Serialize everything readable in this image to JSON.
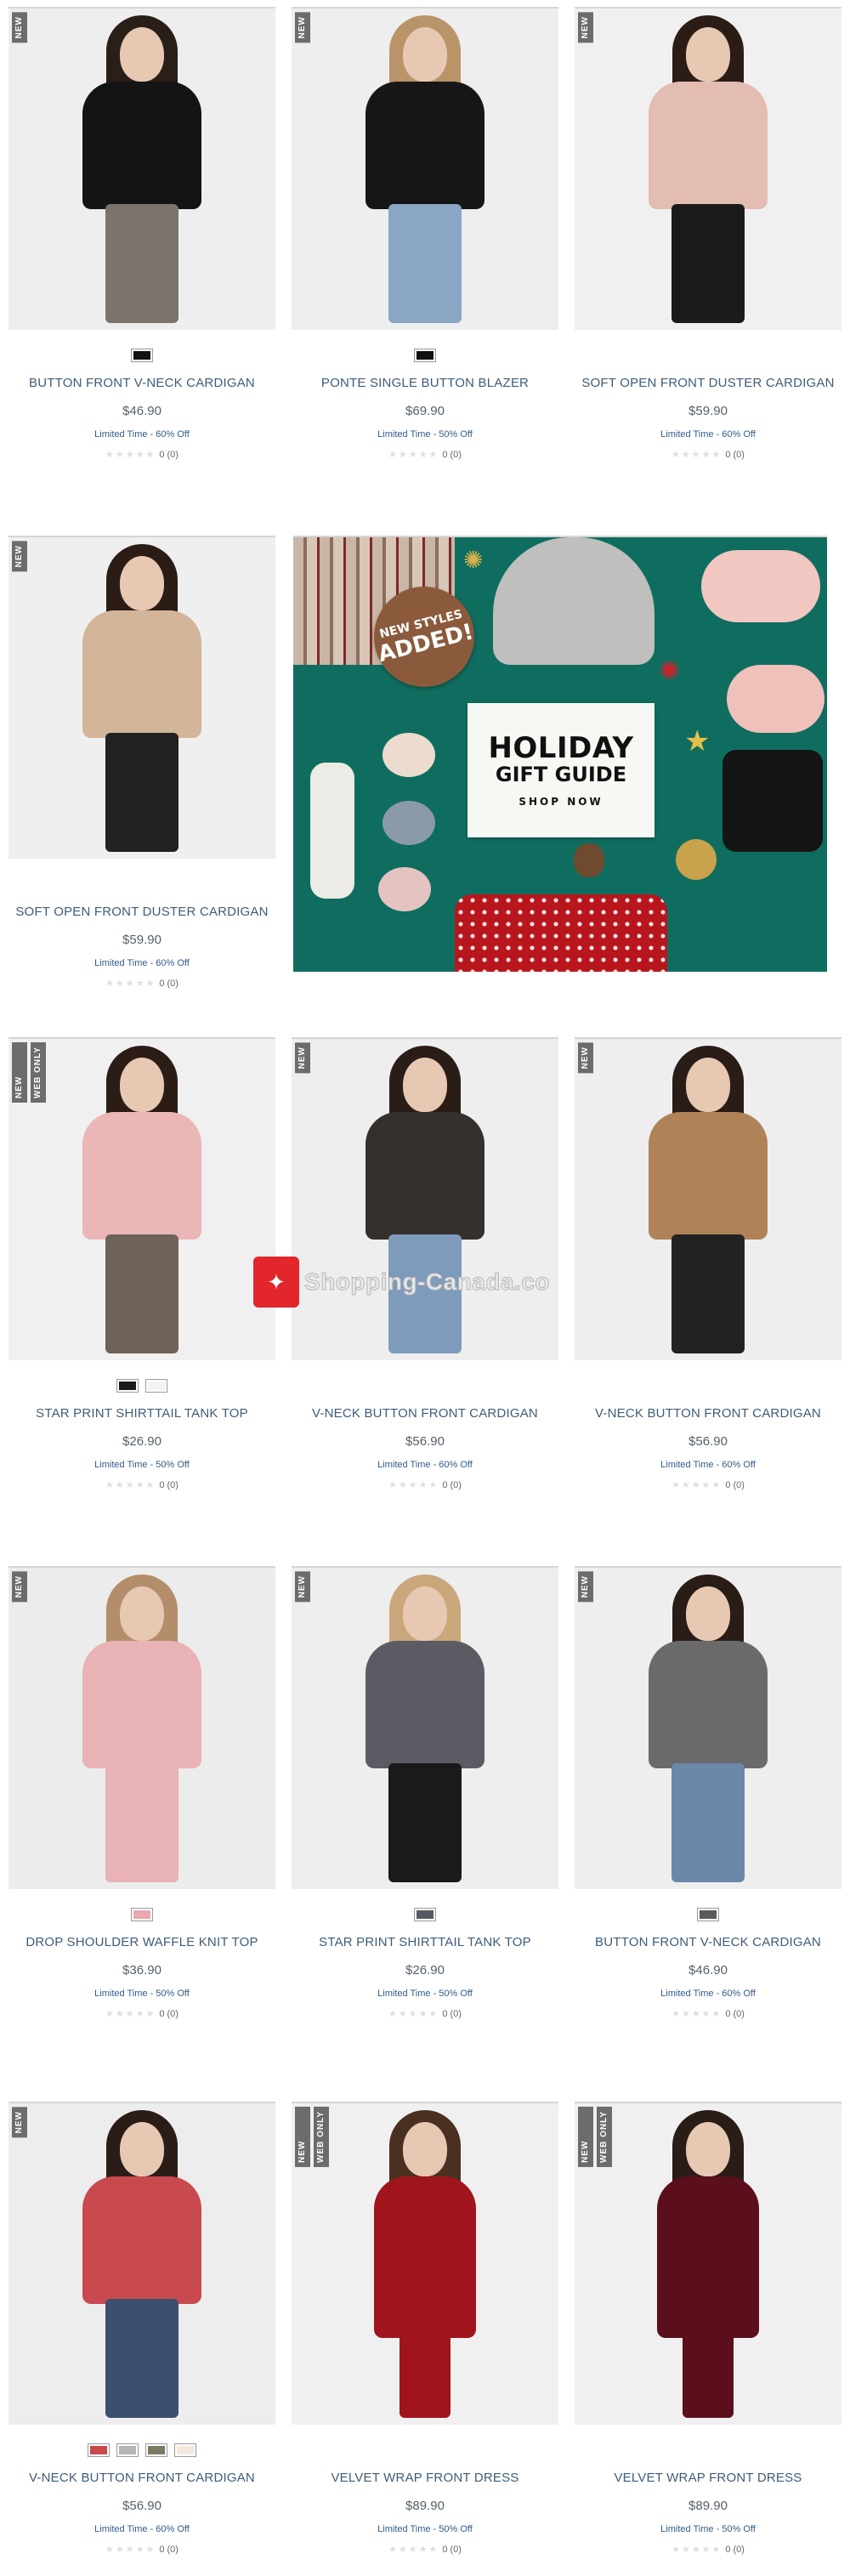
{
  "watermark": {
    "text": "Shopping-Canada.co",
    "icon": "maple-leaf-icon"
  },
  "banner": {
    "stamp_line1": "NEW STYLES",
    "stamp_line2": "ADDED!",
    "title": "HOLIDAY",
    "subtitle": "GIFT GUIDE",
    "cta": "SHOP NOW"
  },
  "products": [
    {
      "name": "BUTTON FRONT V-NECK CARDIGAN",
      "price": "$46.90",
      "promo": "Limited Time - 60% Off",
      "rating_count": "0 (0)",
      "badges": [
        "NEW"
      ],
      "swatches": [
        "#111111"
      ],
      "bg": "#eeeeee",
      "top": "#141414",
      "bottom": "#7a746c",
      "hair": "#2a1e18"
    },
    {
      "name": "PONTE SINGLE BUTTON BLAZER",
      "price": "$69.90",
      "promo": "Limited Time - 50% Off",
      "rating_count": "0 (0)",
      "badges": [
        "NEW"
      ],
      "swatches": [
        "#111111"
      ],
      "bg": "#eeeeee",
      "top": "#161616",
      "bottom": "#8aa6c4",
      "hair": "#b89468"
    },
    {
      "name": "SOFT OPEN FRONT DUSTER CARDIGAN",
      "price": "$59.90",
      "promo": "Limited Time - 60% Off",
      "rating_count": "0 (0)",
      "badges": [
        "NEW"
      ],
      "swatches": [],
      "bg": "#f0f0f0",
      "top": "#e3bcb2",
      "bottom": "#1b1b1b",
      "hair": "#2b1d16"
    },
    {
      "name": "SOFT OPEN FRONT DUSTER CARDIGAN",
      "price": "$59.90",
      "promo": "Limited Time - 60% Off",
      "rating_count": "0 (0)",
      "badges": [
        "NEW"
      ],
      "swatches": [],
      "bg": "#efefef",
      "top": "#d3b59a",
      "bottom": "#222222",
      "hair": "#2b1d16"
    },
    {
      "name": "STAR PRINT SHIRTTAIL TANK TOP",
      "price": "$26.90",
      "promo": "Limited Time - 50% Off",
      "rating_count": "0 (0)",
      "badges": [
        "NEW",
        "WEB ONLY"
      ],
      "swatches": [
        "#1a1a1a",
        "#f2f2ee"
      ],
      "bg": "#f0f0f0",
      "top": "#eab7b6",
      "bottom": "#6e6259",
      "hair": "#2b1d16"
    },
    {
      "name": "V-NECK BUTTON FRONT CARDIGAN",
      "price": "$56.90",
      "promo": "Limited Time - 60% Off",
      "rating_count": "0 (0)",
      "badges": [
        "NEW"
      ],
      "swatches": [],
      "bg": "#eeeeee",
      "top": "#35302c",
      "bottom": "#7f9bbb",
      "hair": "#2a1d17"
    },
    {
      "name": "V-NECK BUTTON FRONT CARDIGAN",
      "price": "$56.90",
      "promo": "Limited Time - 60% Off",
      "rating_count": "0 (0)",
      "badges": [
        "NEW"
      ],
      "swatches": [],
      "bg": "#eeeeee",
      "top": "#b08258",
      "bottom": "#222222",
      "hair": "#2a1d17"
    },
    {
      "name": "DROP SHOULDER WAFFLE KNIT TOP",
      "price": "$36.90",
      "promo": "Limited Time - 50% Off",
      "rating_count": "0 (0)",
      "badges": [
        "NEW"
      ],
      "swatches": [
        "#e8a8ae"
      ],
      "bg": "#ececec",
      "top": "#e9b2b4",
      "bottom": "#e9b2b4",
      "hair": "#b48e6a"
    },
    {
      "name": "STAR PRINT SHIRTTAIL TANK TOP",
      "price": "$26.90",
      "promo": "Limited Time - 50% Off",
      "rating_count": "0 (0)",
      "badges": [
        "NEW"
      ],
      "swatches": [
        "#555a62"
      ],
      "bg": "#eeeeee",
      "top": "#5b5c63",
      "bottom": "#1a1a1a",
      "hair": "#c9a77a"
    },
    {
      "name": "BUTTON FRONT V-NECK CARDIGAN",
      "price": "$46.90",
      "promo": "Limited Time - 60% Off",
      "rating_count": "0 (0)",
      "badges": [
        "NEW"
      ],
      "swatches": [
        "#5a5a5a"
      ],
      "bg": "#eeeeee",
      "top": "#6a6a6a",
      "bottom": "#6b87a9",
      "hair": "#2a1d17"
    },
    {
      "name": "V-NECK BUTTON FRONT CARDIGAN",
      "price": "$56.90",
      "promo": "Limited Time - 60% Off",
      "rating_count": "0 (0)",
      "badges": [
        "NEW"
      ],
      "swatches": [
        "#c8494e",
        "#b5b5b5",
        "#7c7a62",
        "#f2e9dc"
      ],
      "bg": "#ededed",
      "top": "#c8494e",
      "bottom": "#3d4f6e",
      "hair": "#2a1d17"
    },
    {
      "name": "VELVET WRAP FRONT DRESS",
      "price": "$89.90",
      "promo": "Limited Time - 50% Off",
      "rating_count": "0 (0)",
      "badges": [
        "NEW",
        "WEB ONLY"
      ],
      "swatches": [],
      "bg": "#f0f0f0",
      "top": "#a0151c",
      "bottom": "#a0151c",
      "hair": "#4a3020"
    },
    {
      "name": "VELVET WRAP FRONT DRESS",
      "price": "$89.90",
      "promo": "Limited Time - 50% Off",
      "rating_count": "0 (0)",
      "badges": [
        "NEW",
        "WEB ONLY"
      ],
      "swatches": [],
      "bg": "#f0f0f0",
      "top": "#5b0f1c",
      "bottom": "#5b0f1c",
      "hair": "#2a1d17"
    }
  ]
}
